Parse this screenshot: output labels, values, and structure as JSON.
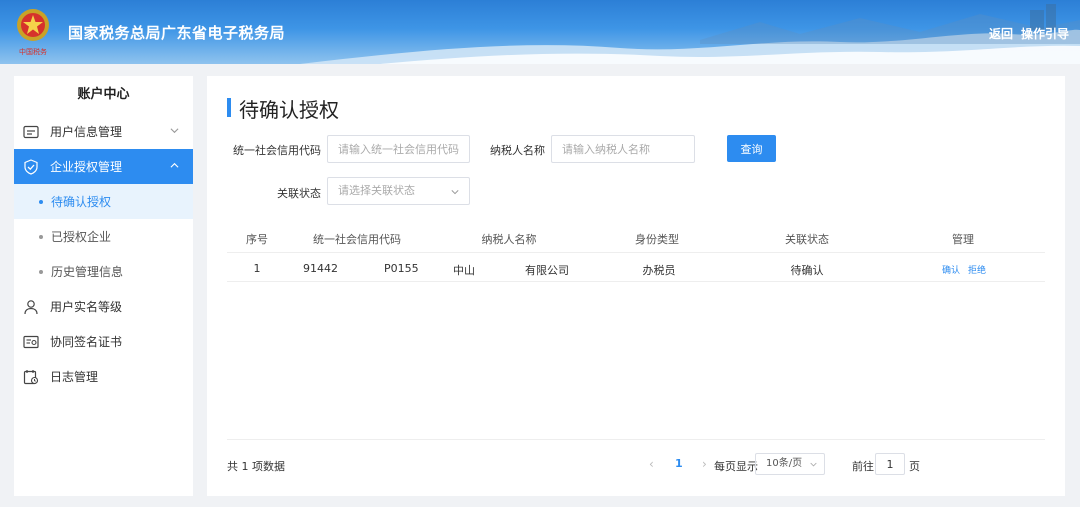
{
  "header": {
    "title": "国家税务总局广东省电子税务局",
    "back_label": "返回",
    "guide_label": "操作引导"
  },
  "sidebar": {
    "title": "账户中心",
    "items": [
      {
        "label": "用户信息管理",
        "icon": "id-card-icon"
      },
      {
        "label": "企业授权管理",
        "icon": "shield-check-icon",
        "active": true
      },
      {
        "label": "用户实名等级",
        "icon": "user-icon"
      },
      {
        "label": "协同签名证书",
        "icon": "certificate-icon"
      },
      {
        "label": "日志管理",
        "icon": "log-calendar-icon"
      }
    ],
    "sub_items": [
      {
        "label": "待确认授权",
        "active": true
      },
      {
        "label": "已授权企业"
      },
      {
        "label": "历史管理信息"
      }
    ]
  },
  "main": {
    "title": "待确认授权",
    "filters": {
      "credit_code_label": "统一社会信用代码",
      "credit_code_placeholder": "请输入统一社会信用代码",
      "taxpayer_label": "纳税人名称",
      "taxpayer_placeholder": "请输入纳税人名称",
      "status_label": "关联状态",
      "status_placeholder": "请选择关联状态",
      "query_label": "查询"
    },
    "table": {
      "columns": [
        "序号",
        "统一社会信用代码",
        "纳税人名称",
        "身份类型",
        "关联状态",
        "管理"
      ],
      "rows": [
        {
          "index": "1",
          "credit_code_prefix": "91442",
          "credit_code_suffix": "P0155",
          "taxpayer_prefix": "中山",
          "taxpayer_suffix": "有限公司",
          "identity": "办税员",
          "status": "待确认",
          "action_confirm": "确认",
          "action_reject": "拒绝"
        }
      ]
    },
    "pagination": {
      "total_text": "共 1 项数据",
      "prev": "‹",
      "current_page": "1",
      "next": "›",
      "page_size_label": "每页显示",
      "page_size_value": "10条/页",
      "goto_label": "前往",
      "goto_value": "1",
      "goto_unit": "页"
    }
  },
  "colors": {
    "accent": "#2d8cf0",
    "header_top": "#2c7fd6",
    "page_bg": "#f0f2f5"
  }
}
